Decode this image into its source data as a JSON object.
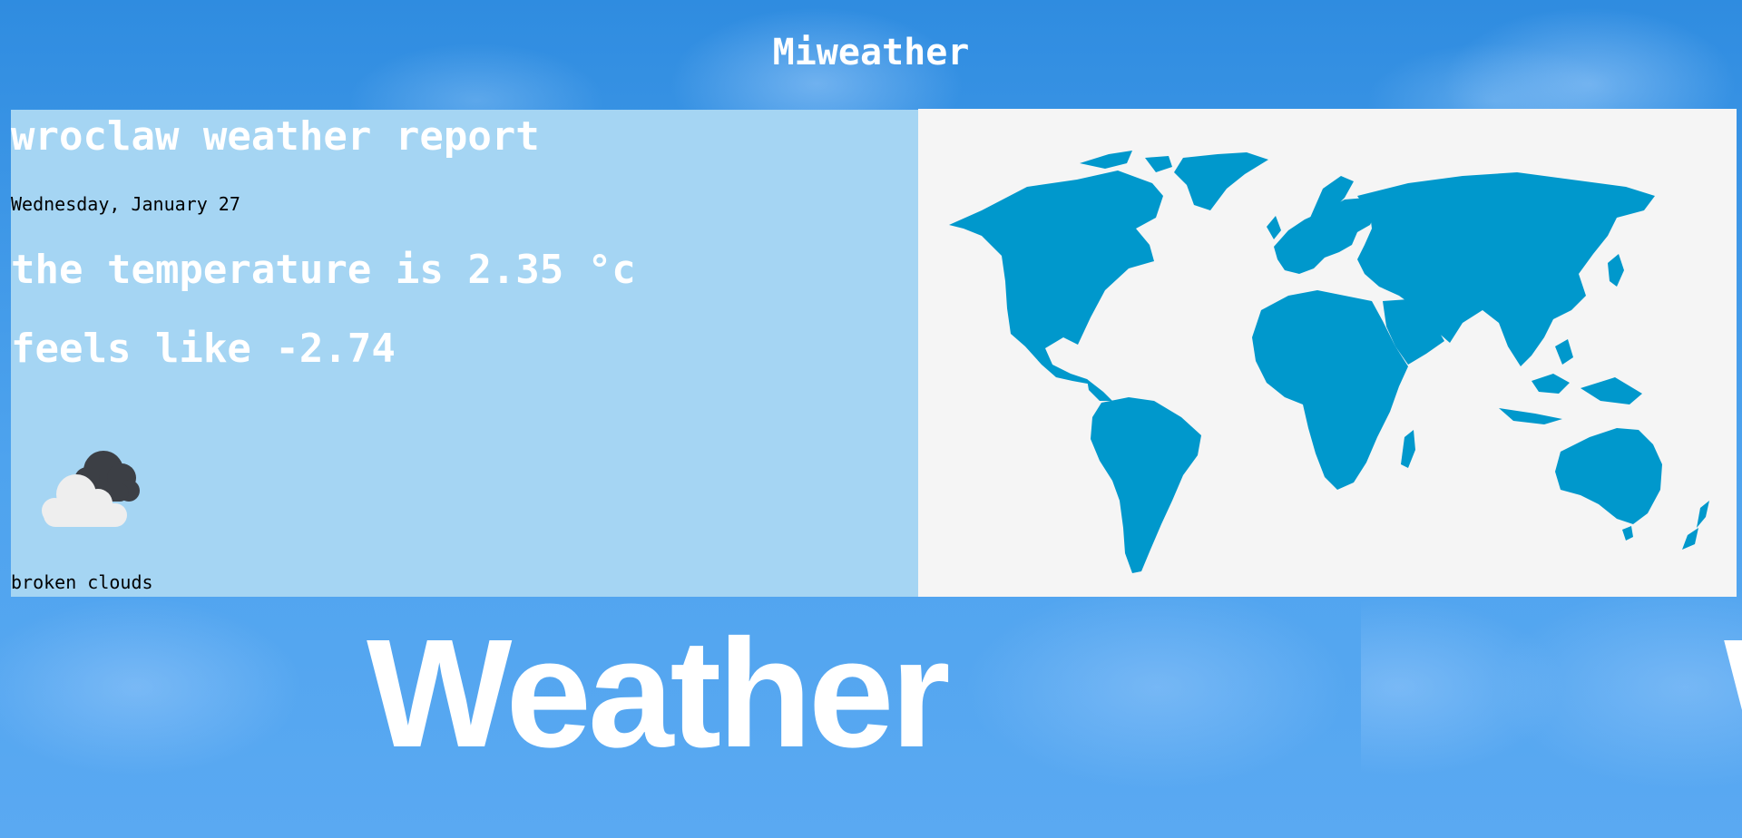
{
  "app": {
    "title": "Miweather"
  },
  "background": {
    "banner_text": "Weather",
    "banner_text_partial": "W"
  },
  "report": {
    "heading": "wroclaw weather report",
    "date": "Wednesday, January 27",
    "temperature": "the temperature is 2.35 °c",
    "feels_like": "feels like -2.74",
    "description": "broken clouds",
    "icon": "broken-clouds-icon"
  },
  "map": {
    "icon": "world-map"
  },
  "colors": {
    "page_background": "#3f9be8",
    "report_background": "#a5d5f3",
    "map_background": "#f5f5f5",
    "continents": "#0098cc",
    "heading_text": "#ffffff",
    "body_text": "#000000"
  }
}
